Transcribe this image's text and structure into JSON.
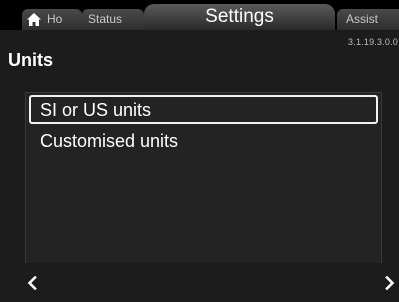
{
  "tabs": {
    "home": {
      "label": "Ho",
      "icon": "home-icon"
    },
    "status": {
      "label": "Status"
    },
    "settings": {
      "label": "Settings"
    },
    "assist": {
      "label": "Assist"
    }
  },
  "version": "3.1.19.3.0.0",
  "page": {
    "title": "Units"
  },
  "list": {
    "items": [
      {
        "label": "SI or US units",
        "selected": true
      },
      {
        "label": "Customised units",
        "selected": false
      }
    ]
  },
  "navigation": {
    "back_icon": "chevron-left-icon",
    "forward_icon": "chevron-right-icon"
  },
  "colors": {
    "background": "#1c1c1c",
    "text": "#ffffff",
    "selection_border": "#f2f2f2"
  }
}
